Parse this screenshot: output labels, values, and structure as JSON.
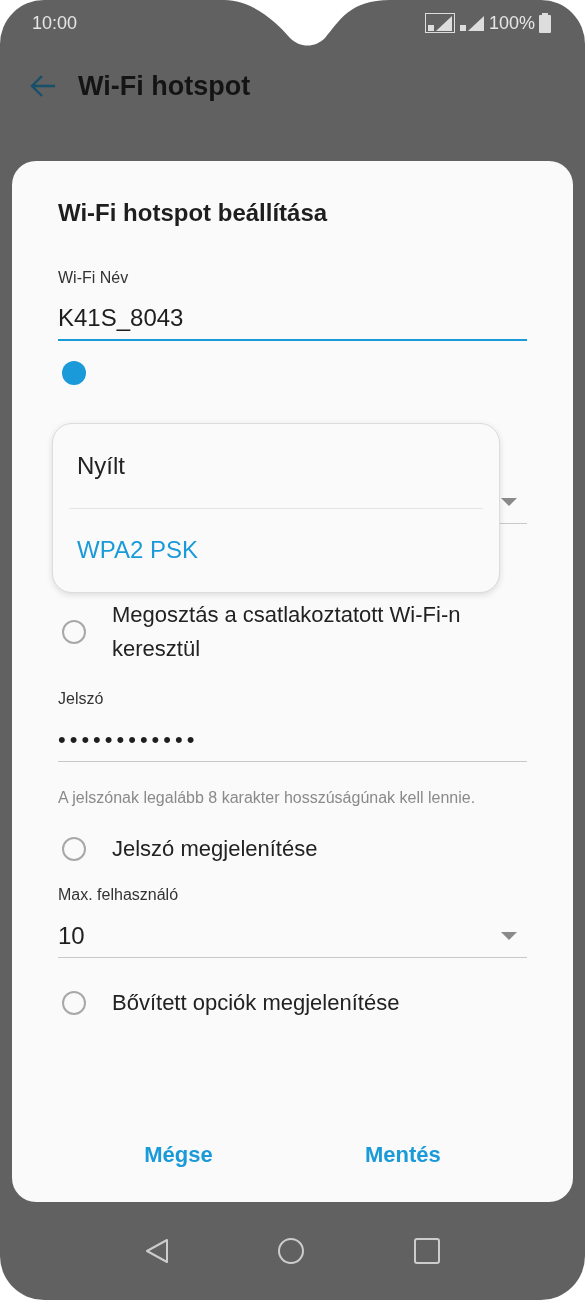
{
  "status_bar": {
    "time": "10:00",
    "battery": "100%"
  },
  "app_bar": {
    "title": "Wi-Fi hotspot"
  },
  "dialog": {
    "title": "Wi-Fi hotspot beállítása",
    "name_field": {
      "label": "Wi-Fi Név",
      "value": "K41S_8043",
      "focused": true
    },
    "hidden_ssid": {
      "checked": true
    },
    "security_menu": {
      "options": [
        {
          "label": "Nyílt",
          "selected": false
        },
        {
          "label": "WPA2 PSK",
          "selected": true
        }
      ]
    },
    "share_option": {
      "label": "Megosztás a csatlakoztatott Wi-Fi-n keresztül",
      "checked": false
    },
    "password_field": {
      "label": "Jelszó",
      "value": "••••••••••••",
      "focused": false
    },
    "password_hint": "A jelszónak legalább 8 karakter hosszúságúnak kell lennie.",
    "show_password": {
      "label": "Jelszó megjelenítése",
      "checked": false
    },
    "max_users": {
      "label": "Max. felhasználó",
      "value": "10"
    },
    "advanced_options": {
      "label": "Bővített opciók megjelenítése",
      "checked": false
    },
    "buttons": [
      "Mégse",
      "Mentés"
    ]
  }
}
